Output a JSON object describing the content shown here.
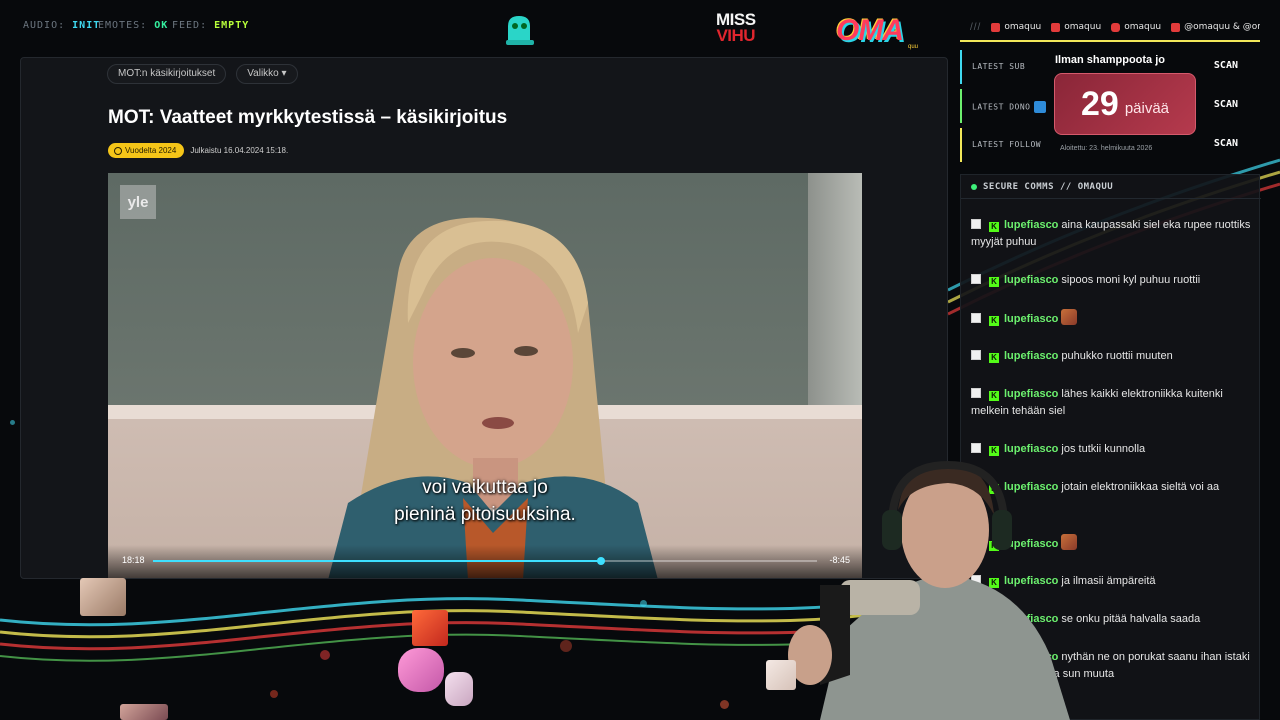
{
  "status": [
    {
      "key": "AUDIO:",
      "value": "INIT"
    },
    {
      "key": "EMOTES:",
      "value": "OK"
    },
    {
      "key": "FEED:",
      "value": "EMPTY"
    }
  ],
  "logos": {
    "miss_top": "MISS",
    "miss_bottom": "VIHU",
    "oma": "OMA",
    "oma_sub": "quu"
  },
  "browser": {
    "crumbs": [
      "MOT:n käsikirjoitukset",
      "Valikko"
    ],
    "article_title": "MOT: Vaatteet myrkkytestissä – käsikirjoitus",
    "tag": "Vuodelta 2024",
    "published": "Julkaistu 16.04.2024 15:18."
  },
  "video": {
    "logo": "yle",
    "subtitle_line1": "voi vaikuttaa jo",
    "subtitle_line2": "pieninä pitoisuuksina.",
    "time_elapsed": "18:18",
    "time_remaining": "-8:45",
    "progress": 0.675
  },
  "social": {
    "slashes": "///",
    "items": [
      {
        "icon": "kick-icon",
        "color": "#e23b3b",
        "label": "omaquu"
      },
      {
        "icon": "twitch-icon",
        "color": "#e23b3b",
        "label": "omaquu"
      },
      {
        "icon": "instagram-icon",
        "color": "#e23b3b",
        "label": "omaquu"
      },
      {
        "icon": "youtube-icon",
        "color": "#e23b3b",
        "label": "@omaquu & @oma"
      }
    ]
  },
  "latest": [
    {
      "label": "LATEST SUB",
      "value": "SCAN",
      "color": "#3fd9f0"
    },
    {
      "label": "LATEST DONO",
      "value": "SCAN",
      "color": "#6cf06e"
    },
    {
      "label": "LATEST FOLLOW",
      "value": "SCAN",
      "color": "#f2e85a"
    }
  ],
  "counter": {
    "title": "Ilman shamppoota jo",
    "number": "29",
    "unit": "päivää",
    "sub": "Aloitettu: 23. helmikuuta 2026"
  },
  "chat": {
    "header": "SECURE COMMS // OMAQUU",
    "messages": [
      {
        "user": "lupefiasco",
        "text": "aina kaupassaki siel eka rupee ruottiks myyjät puhuu",
        "emote": false
      },
      {
        "user": "lupefiasco",
        "text": "sipoos moni kyl puhuu ruottii",
        "emote": false
      },
      {
        "user": "lupefiasco",
        "text": "",
        "emote": true
      },
      {
        "user": "lupefiasco",
        "text": "puhukko ruottii muuten",
        "emote": false
      },
      {
        "user": "lupefiasco",
        "text": "lähes kaikki elektroniikka kuitenki melkein tehään siel",
        "emote": false
      },
      {
        "user": "lupefiasco",
        "text": "jos tutkii kunnolla",
        "emote": false
      },
      {
        "user": "lupefiasco",
        "text": "jotain elektroniikkaa sieltä voi aa",
        "emote": false
      },
      {
        "user": "lupefiasco",
        "text": "",
        "emote": true
      },
      {
        "user": "lupefiasco",
        "text": "ja ilmasii ämpäreitä",
        "emote": false
      },
      {
        "user": "lupefiasco",
        "text": "se onku pitää halvalla saada",
        "emote": false
      },
      {
        "user": "lupefiasco",
        "text": "nythän ne on porukat saanu ihan istaki kaikkee ihottumaa sun muuta",
        "emote": false
      }
    ]
  }
}
